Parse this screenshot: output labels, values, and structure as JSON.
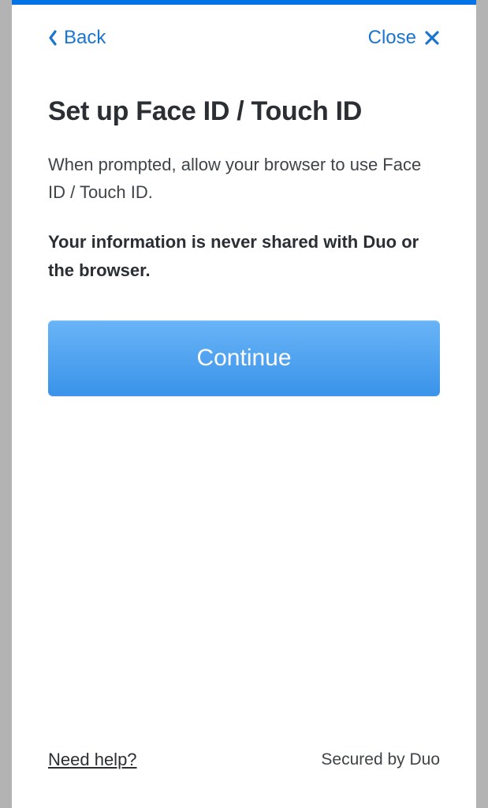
{
  "header": {
    "back_label": "Back",
    "close_label": "Close"
  },
  "main": {
    "title": "Set up Face ID / Touch ID",
    "description": "When prompted, allow your browser to use Face ID / Touch ID.",
    "bold_note": "Your information is never shared with Duo or the browser.",
    "continue_label": "Continue"
  },
  "footer": {
    "help_label": "Need help?",
    "secured_label": "Secured by Duo"
  }
}
